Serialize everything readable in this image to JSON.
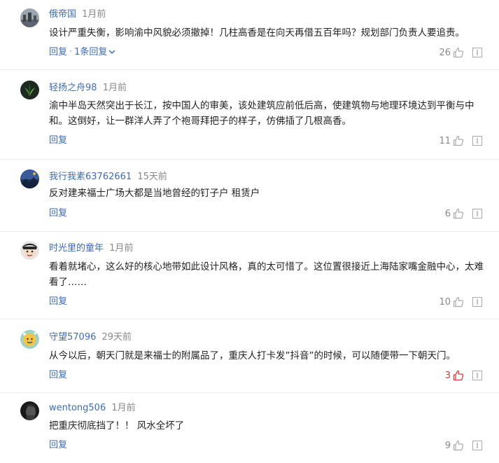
{
  "comments": [
    {
      "username": "俄帝国",
      "time": "1月前",
      "content": "设计严重失衡，影响渝中风貌必须撤掉！几柱高香是在向天再借五百年吗？规划部门负责人要追责。",
      "reply_label": "回复",
      "sub_replies": "1条回复",
      "likes": "26",
      "liked": false
    },
    {
      "username": "轻扬之舟98",
      "time": "1月前",
      "content": "渝中半岛天然突出于长江，按中国人的审美，该处建筑应前低后高，使建筑物与地理环境达到平衡与中和。这倒好，让一群洋人弄了个袍哥拜把子的样子，仿佛插了几根高香。",
      "reply_label": "回复",
      "likes": "11",
      "liked": false
    },
    {
      "username": "我行我素63762661",
      "time": "15天前",
      "content": "反对建来福士广场大都是当地曾经的钉子户 租赁户",
      "reply_label": "回复",
      "likes": "6",
      "liked": false
    },
    {
      "username": "时光里的童年",
      "time": "1月前",
      "content": "看着就堵心，这么好的核心地带如此设计风格，真的太可惜了。这位置很接近上海陆家嘴金融中心，太难看了……",
      "reply_label": "回复",
      "likes": "10",
      "liked": false
    },
    {
      "username": "守望57096",
      "time": "29天前",
      "content": "从今以后，朝天门就是来福士的附属品了，重庆人打卡发”抖音”的时候，可以随便带一下朝天门。",
      "reply_label": "回复",
      "likes": "3",
      "liked": true
    },
    {
      "username": "wentong506",
      "time": "1月前",
      "content": "把重庆彻底挡了！！ 风水全坏了",
      "reply_label": "回复",
      "likes": "9",
      "liked": false
    }
  ],
  "icons": {
    "like": "thumbs-up-icon",
    "report": "report-icon",
    "expand": "chevron-down-icon"
  },
  "colors": {
    "link": "#3d6bb0",
    "liked": "#d73a3a",
    "muted": "#888888"
  }
}
